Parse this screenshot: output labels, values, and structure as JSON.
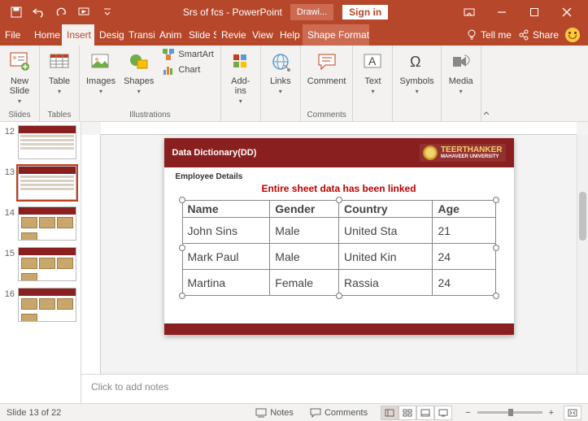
{
  "title": "Srs of fcs  -  PowerPoint",
  "tool_tab": "Drawi...",
  "signin": "Sign in",
  "tabs": [
    "File",
    "Home",
    "Insert",
    "Desig",
    "Transi",
    "Anim",
    "Slide S",
    "Revie",
    "View",
    "Help",
    "Shape Format"
  ],
  "tellme": "Tell me",
  "share": "Share",
  "ribbon": {
    "new_slide": "New\nSlide",
    "table": "Table",
    "images": "Images",
    "shapes": "Shapes",
    "smartart": "SmartArt",
    "chart": "Chart",
    "addins": "Add-\nins",
    "links": "Links",
    "comment": "Comment",
    "text": "Text",
    "symbols": "Symbols",
    "media": "Media",
    "grp_slides": "Slides",
    "grp_tables": "Tables",
    "grp_illus": "Illustrations",
    "grp_comments": "Comments"
  },
  "thumbs": [
    "12",
    "13",
    "14",
    "15",
    "16"
  ],
  "slide": {
    "title": "Data Dictionary(DD)",
    "uni1": "TEERTHANKER",
    "uni2": "MAHAVEER UNIVERSITY",
    "subtitle": "Employee Details",
    "note": "Entire sheet data has been linked",
    "headers": [
      "Name",
      "Gender",
      "Country",
      "Age"
    ],
    "rows": [
      [
        "John Sins",
        "Male",
        "United Sta",
        "21"
      ],
      [
        "Mark Paul",
        "Male",
        "United Kin",
        "24"
      ],
      [
        "Martina",
        "Female",
        "Rassia",
        "24"
      ]
    ]
  },
  "notes_placeholder": "Click to add notes",
  "status": {
    "slide": "Slide 13 of 22",
    "lang": "",
    "notes": "Notes",
    "comments": "Comments",
    "zoom_minus": "−",
    "zoom_plus": "+"
  }
}
